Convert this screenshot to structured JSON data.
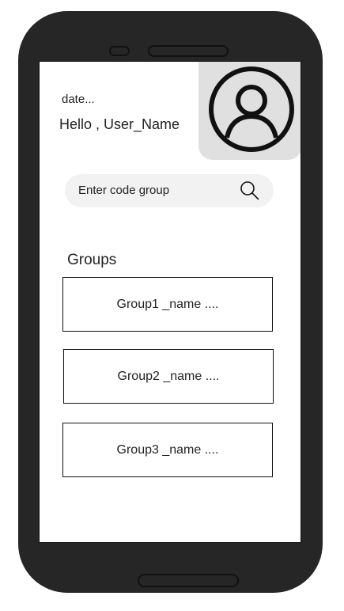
{
  "header": {
    "date": "date...",
    "greeting": "Hello , User_Name",
    "avatar_icon": "user-circle-icon"
  },
  "search": {
    "placeholder": "Enter code group",
    "icon": "search-icon"
  },
  "groups": {
    "title": "Groups",
    "items": [
      {
        "name": "Group1 _name ...."
      },
      {
        "name": "Group2 _name ...."
      },
      {
        "name": "Group3 _name ...."
      }
    ]
  },
  "colors": {
    "phone_body": "#262626",
    "screen": "#ffffff",
    "avatar_bg": "#e0e0e0",
    "search_bg": "#f2f2f2"
  }
}
